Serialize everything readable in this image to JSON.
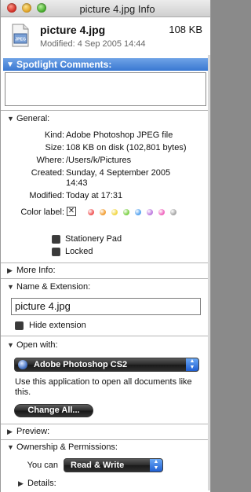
{
  "window": {
    "title": "picture 4.jpg Info"
  },
  "header": {
    "filename": "picture 4.jpg",
    "size": "108 KB",
    "modified": "Modified: 4 Sep 2005 14:44",
    "icon_label": "JPEG"
  },
  "spotlight": {
    "label": "Spotlight Comments:",
    "value": ""
  },
  "general": {
    "label": "General:",
    "kind_label": "Kind:",
    "kind_value": "Adobe Photoshop JPEG file",
    "size_label": "Size:",
    "size_value": "108 KB on disk (102,801 bytes)",
    "where_label": "Where:",
    "where_value": "/Users/k/Pictures",
    "created_label": "Created:",
    "created_value_1": "Sunday, 4 September 2005",
    "created_value_2": "14:43",
    "modified_label": "Modified:",
    "modified_value": "Today at 17:31",
    "color_label": "Color label:",
    "color_none": "✕",
    "color_dots": [
      "#f05b5b",
      "#f2a13a",
      "#f2d84a",
      "#7fd24a",
      "#5aa6f0",
      "#c07fe0",
      "#f06ac0",
      "#a8a8a8"
    ],
    "stationery_label": "Stationery Pad",
    "locked_label": "Locked"
  },
  "more_info": {
    "label": "More Info:"
  },
  "name_ext": {
    "label": "Name & Extension:",
    "name_value": "picture 4.jpg",
    "hide_ext_label": "Hide extension"
  },
  "open_with": {
    "label": "Open with:",
    "app": "Adobe Photoshop CS2",
    "description": "Use this application to open all documents like this.",
    "change_all": "Change All..."
  },
  "preview": {
    "label": "Preview:"
  },
  "ownership": {
    "label": "Ownership & Permissions:",
    "you_can_label": "You can",
    "you_can_value": "Read & Write",
    "details_label": "Details:"
  }
}
